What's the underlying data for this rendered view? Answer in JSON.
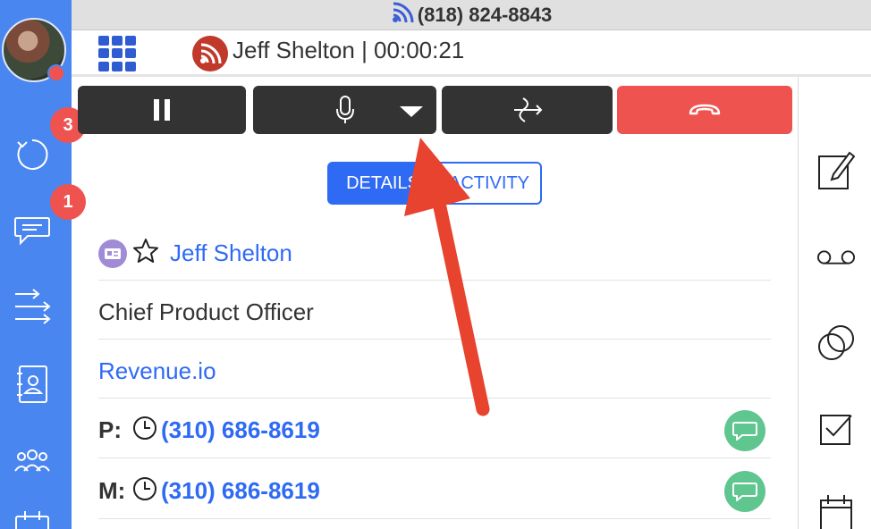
{
  "status_bar": {
    "phone": "(818) 824-8843",
    "icon": "signal-icon"
  },
  "call_header": {
    "caller": "Jeff Shelton",
    "timer": "00:00:21",
    "separator": " | ",
    "icon": "active-call-icon"
  },
  "sidebar": {
    "badges": {
      "history": "3",
      "messages": "1"
    },
    "items": [
      {
        "icon": "refresh-history-icon"
      },
      {
        "icon": "chat-bubble-icon"
      },
      {
        "icon": "transfer-arrows-icon"
      },
      {
        "icon": "contact-card-icon"
      },
      {
        "icon": "group-icon"
      },
      {
        "icon": "calendar-icon"
      }
    ]
  },
  "controls": [
    {
      "icon": "pause-icon"
    },
    {
      "icon": "microphone-icon",
      "dropdown": "caret-down-icon"
    },
    {
      "icon": "transfer-call-icon"
    },
    {
      "icon": "hang-up-icon"
    }
  ],
  "tabs": {
    "details": "DETAILS",
    "activity": "ACTIVITY"
  },
  "contact": {
    "name": "Jeff Shelton",
    "title": "Chief Product Officer",
    "company": "Revenue.io",
    "phones": [
      {
        "label": "P:",
        "number": "(310) 686-8619"
      },
      {
        "label": "M:",
        "number": "(310) 686-8619"
      }
    ]
  },
  "right_panel": [
    {
      "icon": "note-edit-icon"
    },
    {
      "icon": "voicemail-icon"
    },
    {
      "icon": "circles-icon"
    },
    {
      "icon": "checkbox-icon"
    },
    {
      "icon": "calendar-icon"
    }
  ],
  "colors": {
    "sidebar": "#4a86f0",
    "accent": "#2f6af5",
    "danger": "#ef5350",
    "sms": "#5fc690",
    "control": "#333333"
  }
}
